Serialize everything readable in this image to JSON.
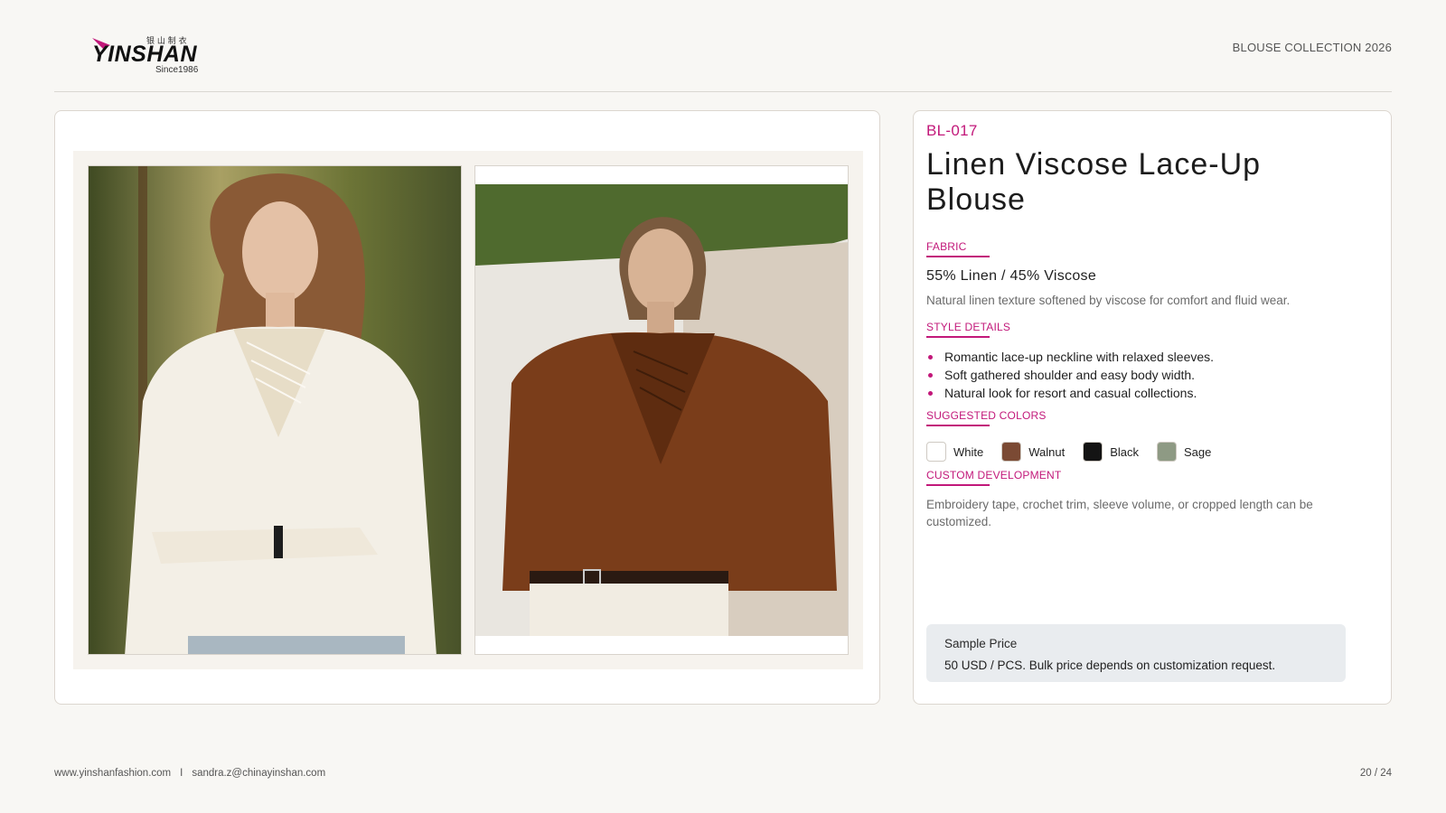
{
  "brand": {
    "logo_wordmark": "YINSHAN",
    "logo_chinese": "银 山 制 衣",
    "logo_since": "Since1986"
  },
  "header": {
    "collection": "BLOUSE COLLECTION 2026"
  },
  "product": {
    "code": "BL-017",
    "title": "Linen Viscose Lace-Up Blouse",
    "images": [
      {
        "icon": "model-white-blouse-photo",
        "garment_color": "#f3efe6"
      },
      {
        "icon": "model-walnut-blouse-photo",
        "garment_color": "#7a3d1a"
      }
    ]
  },
  "sections": {
    "fabric": {
      "label": "FABRIC",
      "main": "55% Linen / 45% Viscose",
      "desc": "Natural linen texture softened by viscose for comfort and fluid wear."
    },
    "style": {
      "label": "STYLE DETAILS",
      "items": [
        "Romantic lace-up neckline with relaxed sleeves.",
        "Soft gathered shoulder and easy body width.",
        "Natural look for resort and casual collections."
      ]
    },
    "colors": {
      "label": "SUGGESTED COLORS",
      "items": [
        {
          "name": "White",
          "hex": "#ffffff"
        },
        {
          "name": "Walnut",
          "hex": "#7b4a34"
        },
        {
          "name": "Black",
          "hex": "#141414"
        },
        {
          "name": "Sage",
          "hex": "#8e9a84"
        }
      ]
    },
    "custom": {
      "label": "CUSTOM DEVELOPMENT",
      "desc": "Embroidery tape, crochet trim, sleeve volume, or cropped length can be customized."
    }
  },
  "price": {
    "title": "Sample Price",
    "text": "50 USD / PCS. Bulk price depends on customization request."
  },
  "footer": {
    "website": "www.yinshanfashion.com",
    "separator": "I",
    "email": "sandra.z@chinayinshan.com",
    "page": "20 / 24"
  },
  "colors": {
    "accent": "#c2187a",
    "background": "#f8f7f4"
  }
}
